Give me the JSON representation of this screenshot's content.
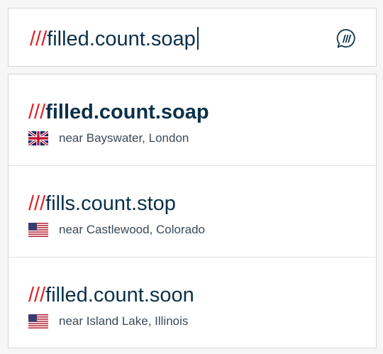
{
  "search": {
    "slashes": "///",
    "value": "filled.count.soap",
    "icon": "what3words-voice-icon"
  },
  "results": [
    {
      "slashes": "///",
      "words": "filled.count.soap",
      "near": "near Bayswater, London",
      "flag": "uk-flag-icon"
    },
    {
      "slashes": "///",
      "words": "fills.count.stop",
      "near": "near Castlewood, Colorado",
      "flag": "us-flag-icon"
    },
    {
      "slashes": "///",
      "words": "filled.count.soon",
      "near": "near Island Lake, Illinois",
      "flag": "us-flag-icon"
    }
  ],
  "colors": {
    "slashes": "#e11f26",
    "text": "#0a3049",
    "background": "#f6f6f6"
  }
}
